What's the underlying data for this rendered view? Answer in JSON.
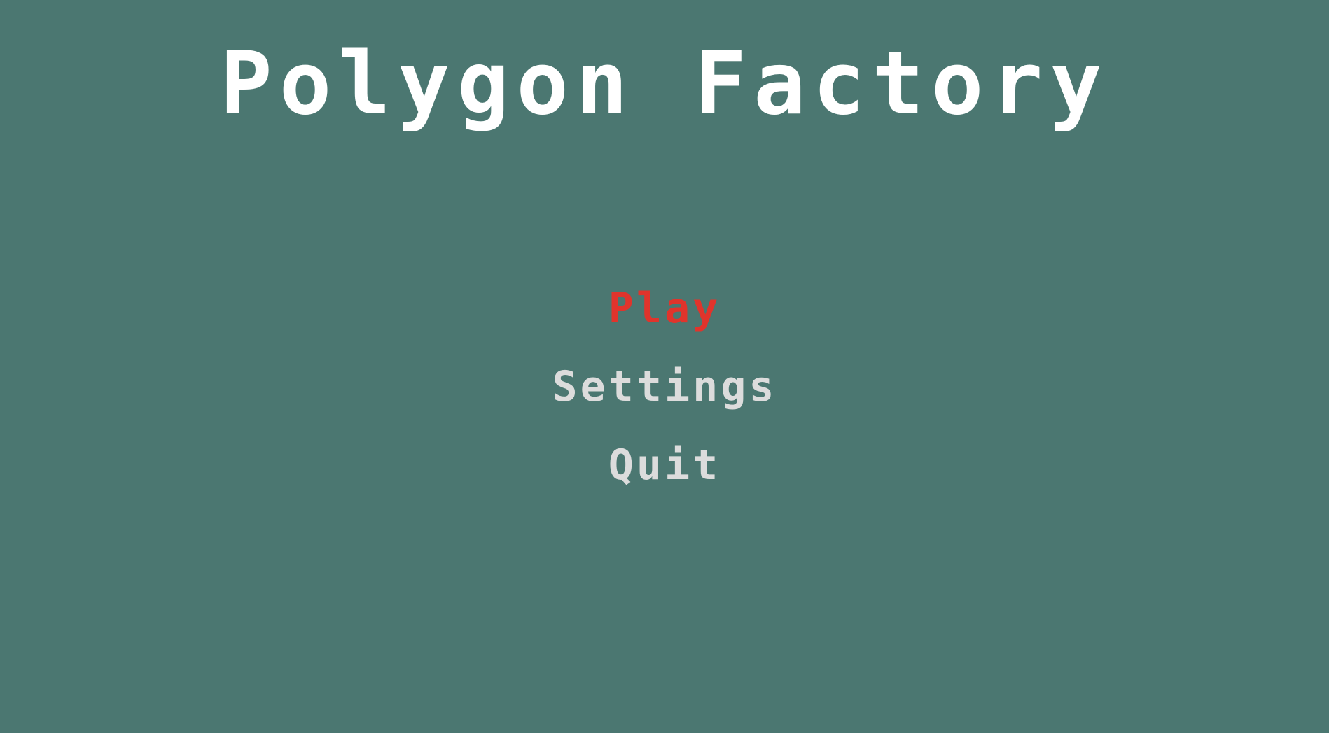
{
  "game": {
    "title": "Polygon Factory"
  },
  "menu": {
    "items": [
      {
        "label": "Play",
        "selected": true
      },
      {
        "label": "Settings",
        "selected": false
      },
      {
        "label": "Quit",
        "selected": false
      }
    ]
  },
  "colors": {
    "background": "#4b7771",
    "title": "#ffffff",
    "menu_item": "#dcdcdc",
    "menu_item_selected": "#e0342c"
  }
}
